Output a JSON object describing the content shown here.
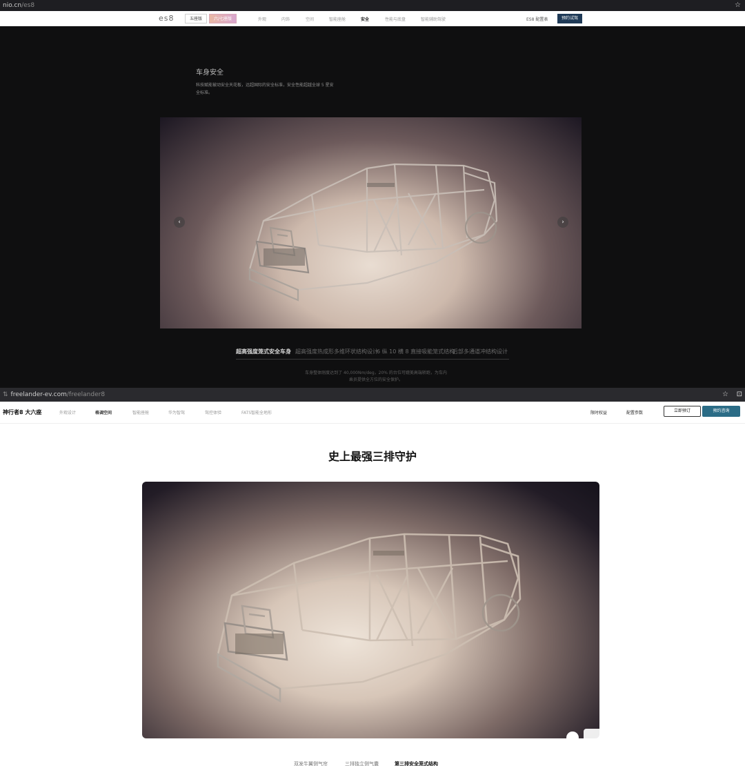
{
  "top_browser": {
    "url_domain": "nio.cn",
    "url_path": "/es8"
  },
  "nio_nav": {
    "logo": "es8",
    "variant_pills": [
      "五座版",
      "六/七座版"
    ],
    "links": [
      "外观",
      "内饰",
      "空间",
      "智能座舱",
      "安全",
      "性能与底盘",
      "智能辅助驾驶"
    ],
    "current_link": "安全",
    "config_link": "ES8 配置表",
    "book_button": "预约试驾"
  },
  "nio_section": {
    "title": "车身安全",
    "description": "科技赋能被动安全天花板，远超国际的安全标准，安全性能超越全球 5 星安全标准。",
    "tabs": [
      "超高强度笼式安全车身",
      "超高强度热成形多维环状结构设计",
      "6 纵 10 横 8 直接吸能笼式结构",
      "后部多通道冲结构设计"
    ],
    "active_tab_index": 0,
    "caption": "车身整体刚度达到了 40,000Nm/deg，20% 的台位可媲美高端轿跑，为车内乘员提供全方位的安全保护。"
  },
  "bottom_browser": {
    "url_domain": "freelander-ev.com",
    "url_path": "/freelander8"
  },
  "fl_nav": {
    "brand": "神行者8 大六座",
    "links": [
      "外观设计",
      "格调空间",
      "智能座舱",
      "华为智驾",
      "驾控体验",
      "FATS智能全地形"
    ],
    "current_link": "格调空间",
    "right_links": [
      "限时权益",
      "配置参数"
    ],
    "order_button": "立即预订",
    "consult_button": "预约咨询"
  },
  "fl_section": {
    "headline": "史上最强三排守护",
    "tabs": [
      "双发牛翼侧气帘",
      "三排独立侧气囊",
      "第三排安全笼式结构"
    ],
    "active_tab_index": 2
  },
  "icons": {
    "prev": "chevron-left-icon",
    "next": "chevron-right-icon",
    "bookmark": "star-icon"
  },
  "colors": {
    "nio_book": "#1f3a57",
    "fl_consult": "#2b6c86"
  }
}
